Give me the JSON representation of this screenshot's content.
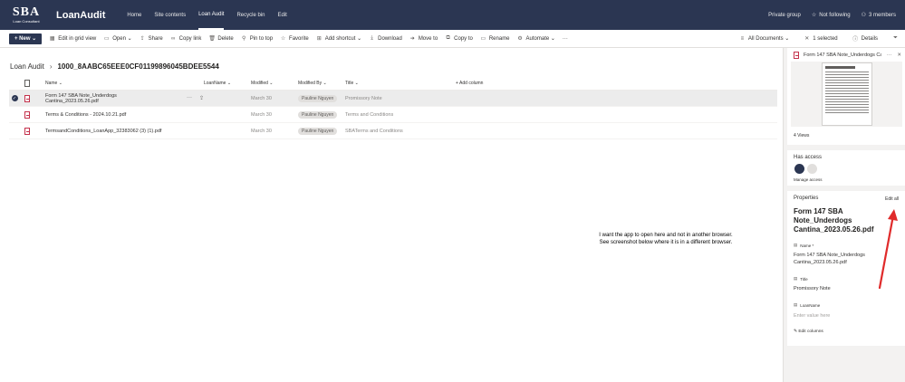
{
  "topbar": {
    "logo_big": "SBA",
    "logo_small": "Loan Consultant",
    "site_title": "LoanAudit",
    "nav": [
      "Home",
      "Site contents",
      "Loan Audit",
      "Recycle bin",
      "Edit"
    ],
    "private_group": "Private group",
    "not_following": "Not following",
    "members": "3 members"
  },
  "commands": {
    "new": "New",
    "items": [
      "Edit in grid view",
      "Open",
      "Share",
      "Copy link",
      "Delete",
      "Pin to top",
      "Favorite",
      "Add shortcut",
      "Download",
      "Move to",
      "Copy to",
      "Rename",
      "Automate"
    ],
    "more": "···",
    "all_documents": "All Documents",
    "selected": "1 selected",
    "details": "Details"
  },
  "breadcrumb": {
    "parent": "Loan Audit",
    "separator": "›",
    "current": "1000_8AABC65EEE0CF01199896045BDEE5544"
  },
  "list": {
    "headers": {
      "name": "Name",
      "loan": "LoanName",
      "modified": "Modified",
      "modified_by": "Modified By",
      "title": "Title",
      "add_column": "+ Add column"
    },
    "rows": [
      {
        "name": "Form 147 SBA Note_Underdogs Cantina_2023.05.26.pdf",
        "modified": "March 30",
        "modified_by": "Pauline Nguyen",
        "title": "Promissory Note"
      },
      {
        "name": "Terms & Conditions - 2024.10.21.pdf",
        "modified": "March 30",
        "modified_by": "Pauline Nguyen",
        "title": "Terms and Conditions"
      },
      {
        "name": "TermsandConditions_LoanApp_32383062 (3) (1).pdf",
        "modified": "March 30",
        "modified_by": "Pauline Nguyen",
        "title": "SBATerms and Conditions"
      }
    ]
  },
  "pane": {
    "file_title": "Form 147 SBA Note_Underdogs Cantina_2023.05.26.pdf",
    "views": "4 Views",
    "has_access": "Has access",
    "manage_access": "Manage access",
    "properties": "Properties",
    "edit_all": "Edit all",
    "file_name_heading": "Form 147 SBA Note_Underdogs Cantina_2023.05.26.pdf",
    "name_label": "Name *",
    "name_value": "Form 147 SBA Note_Underdogs Cantina_2023.05.26.pdf",
    "title_label": "Title",
    "title_value": "Promissory Note",
    "loanname_label": "LoanName",
    "loanname_placeholder": "Enter value here",
    "edit_columns": "Edit columns"
  },
  "annotation": {
    "text": "I want the app to open here and not in another browser.  See screenshot below where it is in a different browser."
  },
  "colors": {
    "brand": "#2b3652",
    "arrow": "#e02b2b",
    "pdf": "#c4314b"
  }
}
